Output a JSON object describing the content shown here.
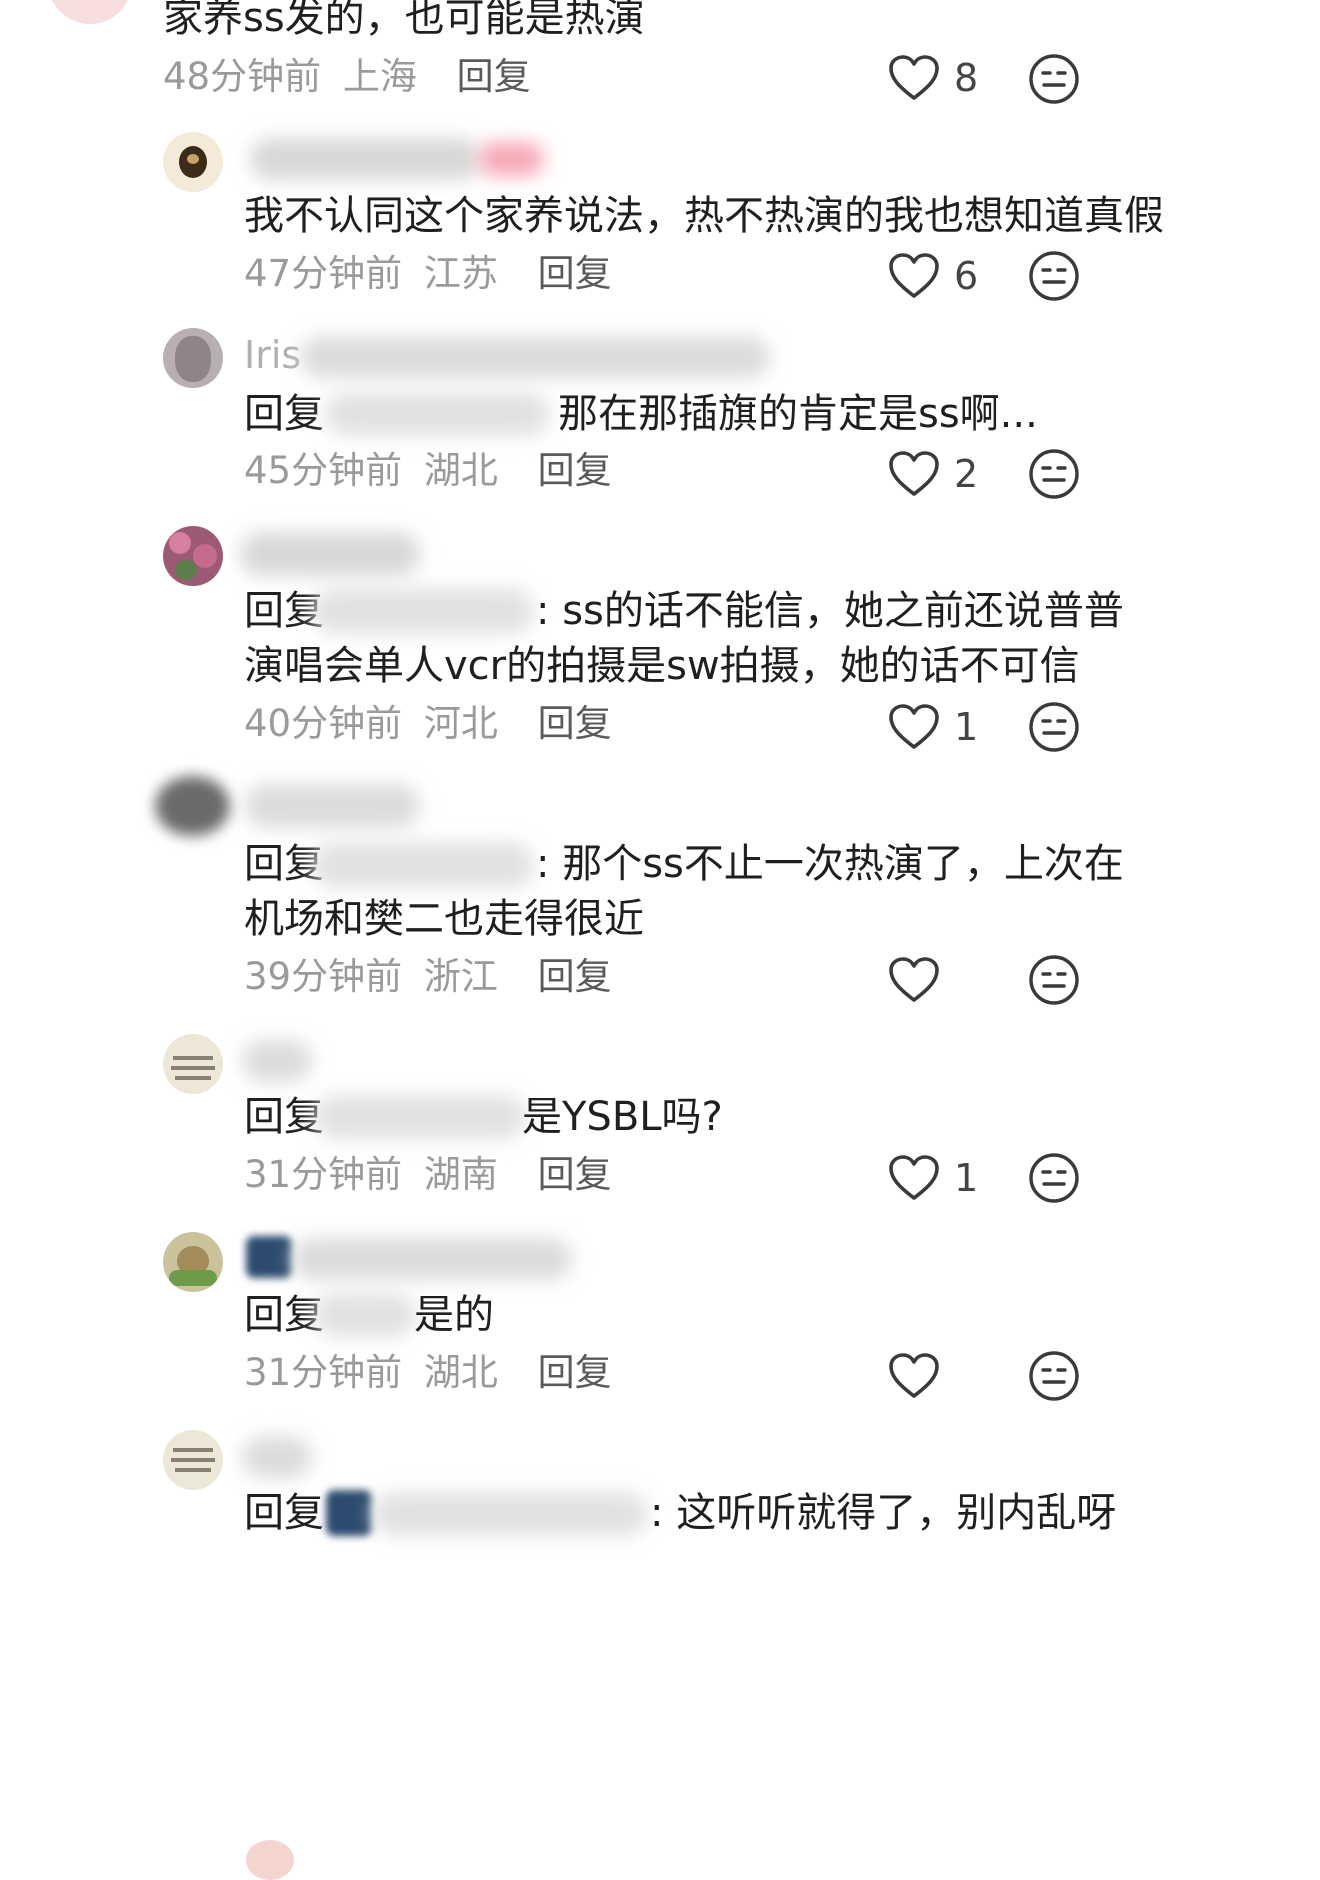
{
  "comments": [
    {
      "text": "家养ss发的，也可能是热演",
      "time": "48分钟前",
      "location": "上海",
      "reply_label": "回复",
      "likes": "8"
    },
    {
      "text": "我不认同这个家养说法，热不热演的我也想知道真假",
      "time": "47分钟前",
      "location": "江苏",
      "reply_label": "回复",
      "likes": "6"
    },
    {
      "username": "Iris",
      "reply_prefix": "回复",
      "text": "那在那插旗的肯定是ss啊...",
      "time": "45分钟前",
      "location": "湖北",
      "reply_label": "回复",
      "likes": "2"
    },
    {
      "reply_prefix": "回复",
      "text_line1": ": ss的话不能信，她之前还说普普",
      "text_line2": "演唱会单人vcr的拍摄是sw拍摄，她的话不可信",
      "time": "40分钟前",
      "location": "河北",
      "reply_label": "回复",
      "likes": "1"
    },
    {
      "reply_prefix": "回复",
      "text_line1": ": 那个ss不止一次热演了，上次在",
      "text_line2": "机场和樊二也走得很近",
      "time": "39分钟前",
      "location": "浙江",
      "reply_label": "回复",
      "likes": ""
    },
    {
      "reply_prefix": "回复",
      "text": "是YSBL吗?",
      "time": "31分钟前",
      "location": "湖南",
      "reply_label": "回复",
      "likes": "1"
    },
    {
      "reply_prefix": "回复",
      "text": "是的",
      "time": "31分钟前",
      "location": "湖北",
      "reply_label": "回复",
      "likes": ""
    },
    {
      "reply_prefix": "回复",
      "text": ": 这听听就得了，别内乱呀"
    }
  ],
  "icons": {
    "like": "heart-icon",
    "emoji": "neutral-face-icon"
  },
  "colors": {
    "text": "#1f1f1f",
    "meta": "#9a9a9a",
    "icon": "#3a3a3a"
  }
}
